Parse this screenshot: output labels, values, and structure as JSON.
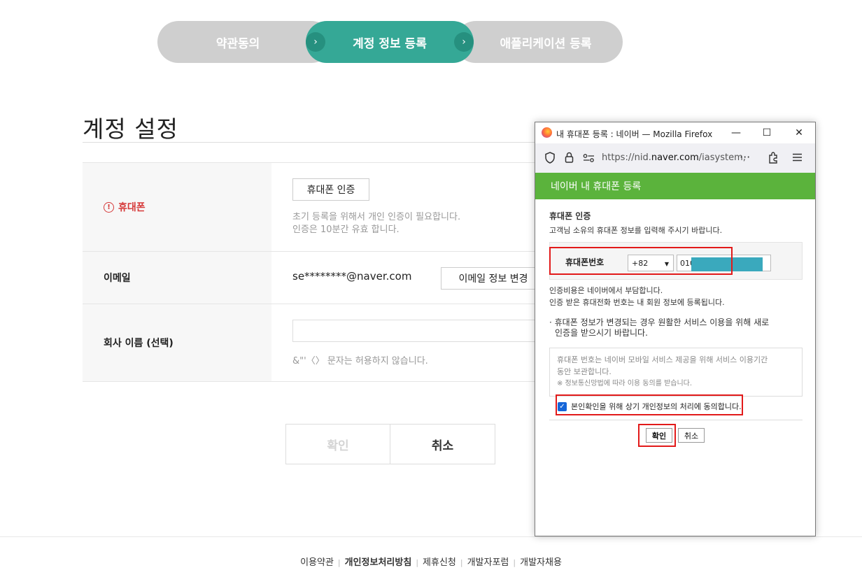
{
  "steps": {
    "step1": "약관동의",
    "step2": "계정 정보 등록",
    "step3": "애플리케이션 등록",
    "chevron": "›"
  },
  "page": {
    "title": "계정 설정"
  },
  "form": {
    "phone": {
      "label": "휴대폰",
      "warn_glyph": "!",
      "button": "휴대폰 인증",
      "help_line1": "초기 등록을 위해서 개인 인증이 필요합니다.",
      "help_line2": "인증은 10분간 유효 합니다."
    },
    "email": {
      "label": "이메일",
      "value": "se********@naver.com",
      "button": "이메일 정보 변경"
    },
    "company": {
      "label": "회사 이름 (선택)",
      "value": "",
      "help": "&\"'〈〉 문자는 허용하지 않습니다."
    },
    "confirm": "확인",
    "cancel": "취소"
  },
  "footer": {
    "links": [
      "이용약관",
      "개인정보처리방침",
      "제휴신청",
      "개발자포럼",
      "개발자채용"
    ],
    "separator": "|"
  },
  "popup": {
    "window_title": "내 휴대폰 등록 : 네이버 — Mozilla Firefox",
    "controls": {
      "minimize": "—",
      "maximize": "☐",
      "close": "✕"
    },
    "url_prefix": "https://nid.",
    "url_domain": "naver.com",
    "url_rest": "/iasystem,",
    "url_more": "···",
    "header": "네이버 내 휴대폰 등록",
    "section_title": "휴대폰 인증",
    "section_sub": "고객님 소유의 휴대폰 정보를 입력해 주시기 바랍니다.",
    "phone_label": "휴대폰번호",
    "country_code": "+82",
    "phone_value": "010",
    "note_line1": "인증비용은 네이버에서 부담합니다.",
    "note_line2": "인증 받은 휴대전화 번호는 내 회원 정보에 등록됩니다.",
    "notice_line1": "· 휴대폰 정보가 변경되는 경우 원활한 서비스 이용을 위해 새로",
    "notice_line2": "인증을 받으시기 바랍니다.",
    "terms_line1": "휴대폰 번호는 네이버 모바일 서비스 제공을 위해 서비스 이용기간",
    "terms_line2": "동안 보관합니다.",
    "terms_line3": "※ 정보통신망법에 따라 이용 동의를 받습니다.",
    "agree_label": "본인확인을 위해 상기 개인정보의 처리에 동의합니다.",
    "agree_checked": true,
    "ok": "확인",
    "cancel": "취소",
    "colors": {
      "header_green": "#5bb33c",
      "highlight_red": "#e21a1a",
      "mask": "#3aa9bd"
    }
  },
  "colors": {
    "step_active": "#35a896",
    "step_inactive": "#cfcfcf",
    "warn": "#d63a3a"
  }
}
